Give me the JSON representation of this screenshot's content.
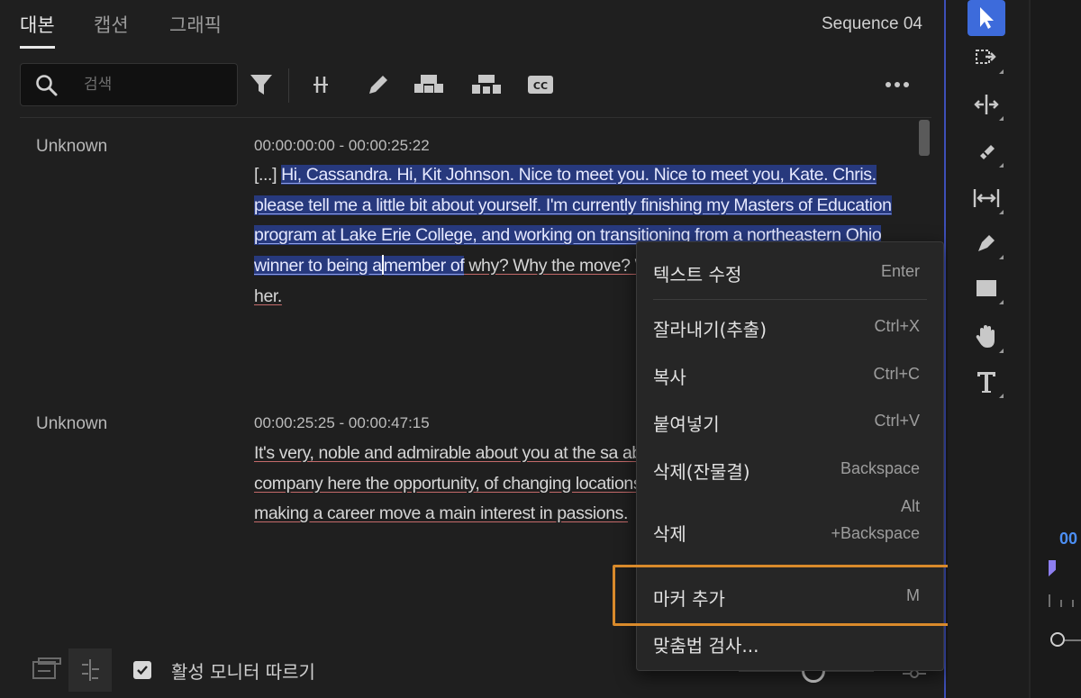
{
  "tabs": [
    {
      "label": "대본"
    },
    {
      "label": "캡션"
    },
    {
      "label": "그래픽"
    }
  ],
  "sequence_name": "Sequence 04",
  "search": {
    "placeholder": "검색",
    "value": ""
  },
  "toolbar_icons": [
    "search-icon",
    "filter-icon",
    "split-icon",
    "pencil-icon",
    "merge-icon",
    "split-segment-icon",
    "cc-icon",
    "more-icon"
  ],
  "segments": [
    {
      "speaker": "Unknown",
      "timecode": "00:00:00:00 - 00:00:25:22",
      "prefix": "[...] ",
      "highlighted_text": "Hi, Cassandra. Hi, Kit Johnson. Nice to meet you. Nice to meet you, Kate. Chris. please tell me a little bit about yourself. I'm currently finishing my Masters of Education program at Lake Erie College, and working on transitioning from a northeastern Ohio winner to being a",
      "after_caret": "member of",
      "rest_text": " why? Why the move? Well, my wife's job is movi along with her."
    },
    {
      "speaker": "Unknown",
      "timecode": "00:00:25:25 - 00:00:47:15",
      "text": "It's very, noble and admirable about you at the sa about the position open with our company here the opportunity, of changing locations and movin another, I thought about making a career move a main interest in passions."
    }
  ],
  "context_menu": {
    "items": [
      {
        "label": "텍스트 수정",
        "shortcut": "Enter"
      },
      {
        "label": "잘라내기(추출)",
        "shortcut": "Ctrl+X"
      },
      {
        "label": "복사",
        "shortcut": "Ctrl+C"
      },
      {
        "label": "붙여넣기",
        "shortcut": "Ctrl+V"
      },
      {
        "label": "삭제(잔물결)",
        "shortcut": "Backspace"
      },
      {
        "label": "삭제",
        "shortcut_line1": "Alt",
        "shortcut_line2": "+Backspace"
      },
      {
        "label": "마커 추가",
        "shortcut": "M"
      },
      {
        "label": "맞춤법 검사..."
      }
    ],
    "highlight_color": "#d98a2b"
  },
  "bottom": {
    "follow_monitor_label": "활성 모니터 따르기",
    "follow_monitor_checked": true
  },
  "tools": [
    "selection-tool-icon",
    "track-select-tool-icon",
    "ripple-edit-tool-icon",
    "razor-tool-icon",
    "slip-tool-icon",
    "pen-tool-icon",
    "rectangle-tool-icon",
    "hand-tool-icon",
    "type-tool-icon"
  ],
  "timeline": {
    "time_prefix": "00"
  },
  "colors": {
    "accent": "#3d6bdb",
    "selection": "#27397d",
    "menu_highlight": "#d98a2b",
    "timecode_blue": "#4c8ff5"
  }
}
